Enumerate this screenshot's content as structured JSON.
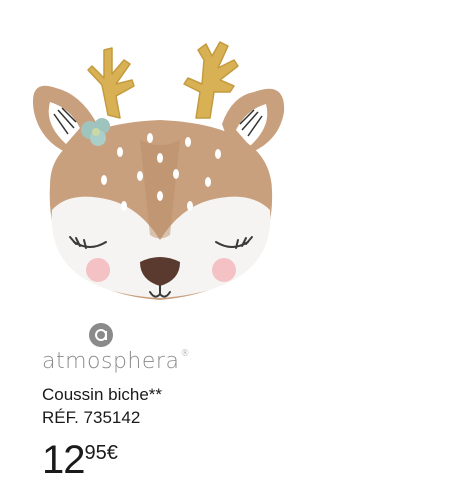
{
  "brand": {
    "name": "atmosphera",
    "reg": "®",
    "icon": "atmosphera-logo-icon"
  },
  "product": {
    "name": "Coussin biche",
    "name_suffix": "**",
    "reference": "RÉF. 735142",
    "image": "deer-cushion-image"
  },
  "price": {
    "integer": "12",
    "decimals": "95€"
  },
  "colors": {
    "text": "#1a1a1a",
    "brand_grey": "#8a8a8a",
    "antler_gold": "#d9b155",
    "fur": "#c9a07e"
  }
}
